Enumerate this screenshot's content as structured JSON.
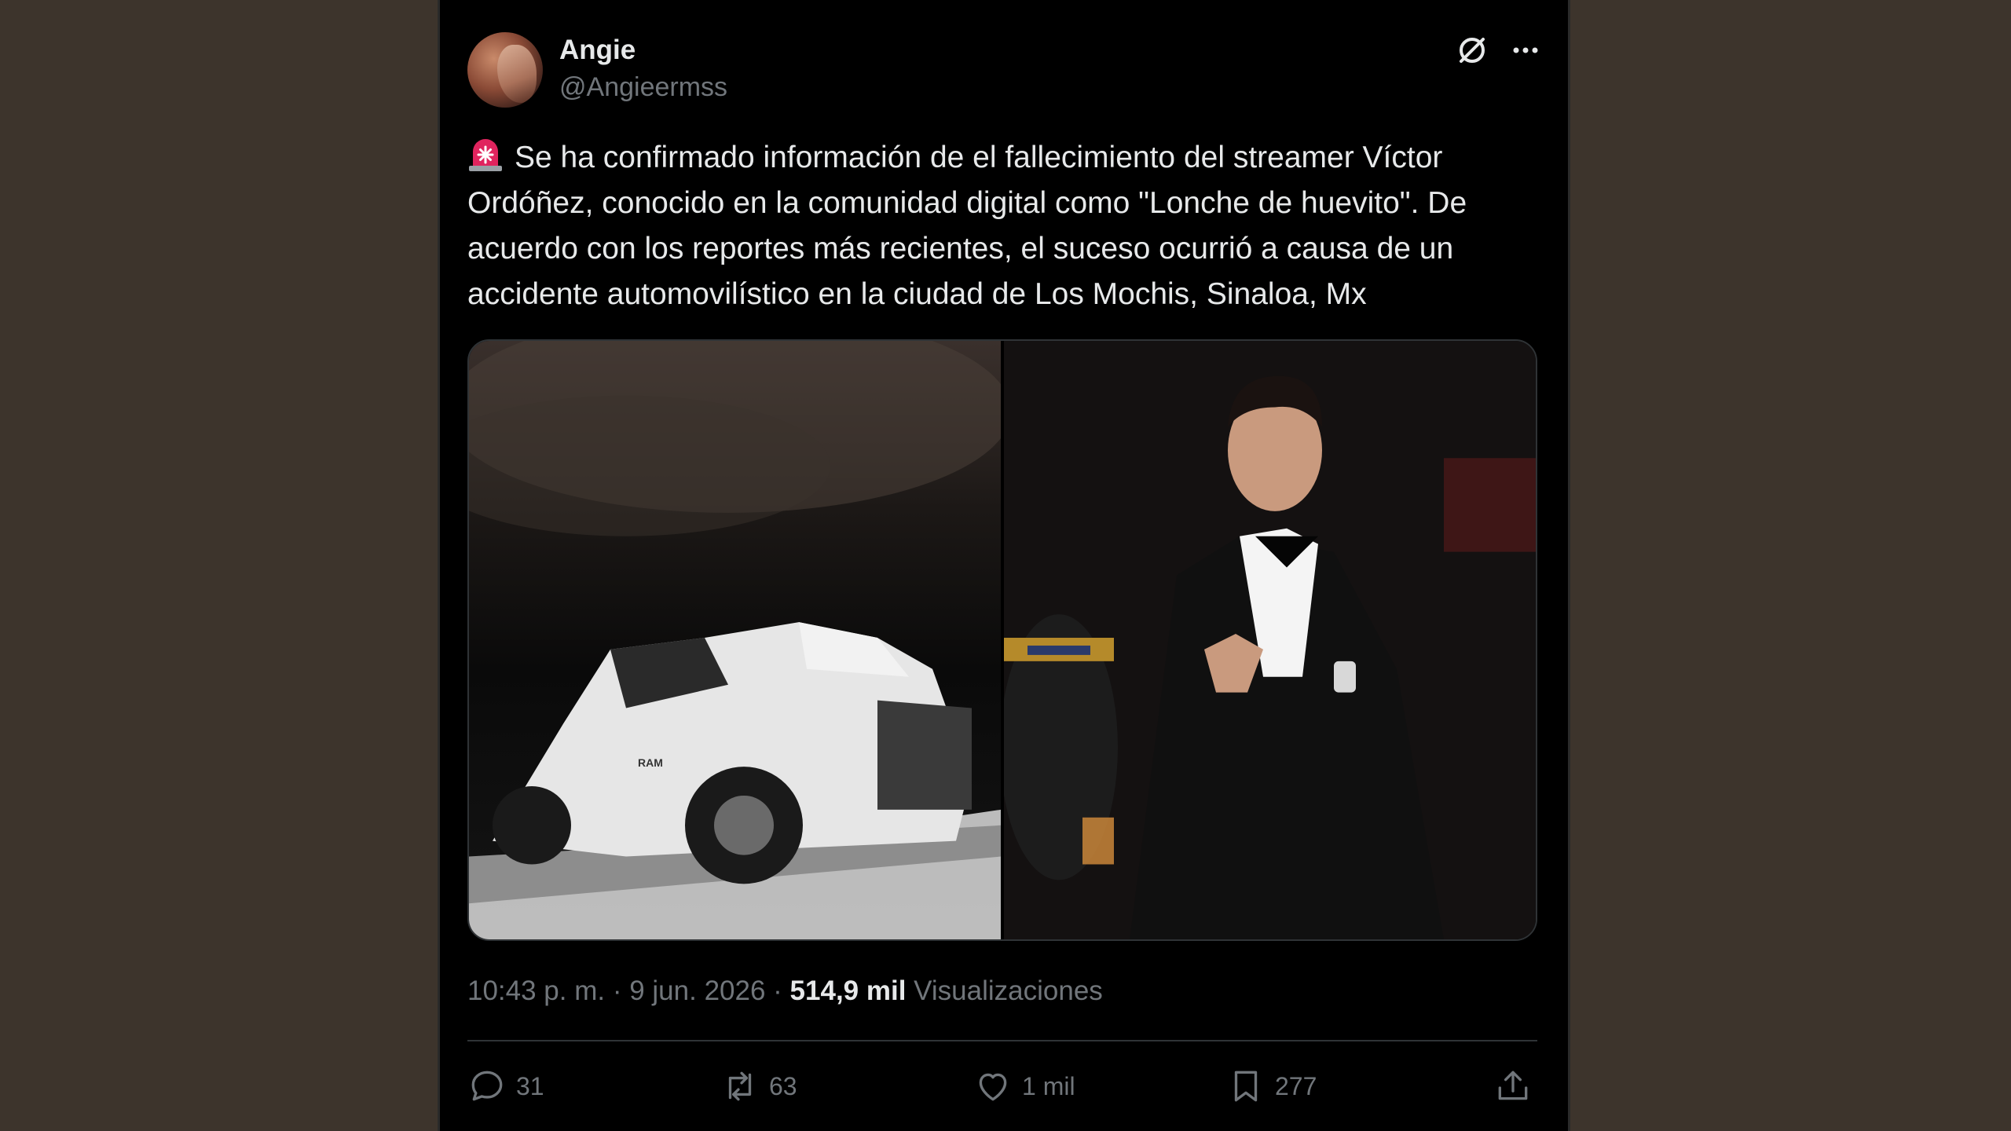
{
  "author": {
    "display_name": "Angie",
    "handle": "@Angieermss"
  },
  "tweet": {
    "emoji": "siren-icon",
    "text": "Se ha confirmado información de el fallecimiento del streamer Víctor Ordóñez, conocido en la comunidad digital como \"Lonche de huevito\". De acuerdo con los reportes más recientes, el suceso ocurrió a causa de un accidente automovilístico en la ciudad de Los Mochis, Sinaloa, Mx"
  },
  "media": {
    "photo_left_icon": "damaged-truck-photo",
    "photo_left_brand": "RAM",
    "photo_right_icon": "man-in-tuxedo-photo"
  },
  "meta": {
    "time": "10:43 p. m.",
    "separator1": " · ",
    "date": "9 jun. 2026",
    "separator2": " · ",
    "views_count": "514,9 mil",
    "views_label": "Visualizaciones"
  },
  "actions": {
    "replies": "31",
    "reposts": "63",
    "likes": "1 mil",
    "bookmarks": "277"
  },
  "colors": {
    "background": "#3d342c",
    "card": "#000000",
    "text": "#e7e9ea",
    "muted": "#71767b",
    "divider": "#2f3336"
  }
}
